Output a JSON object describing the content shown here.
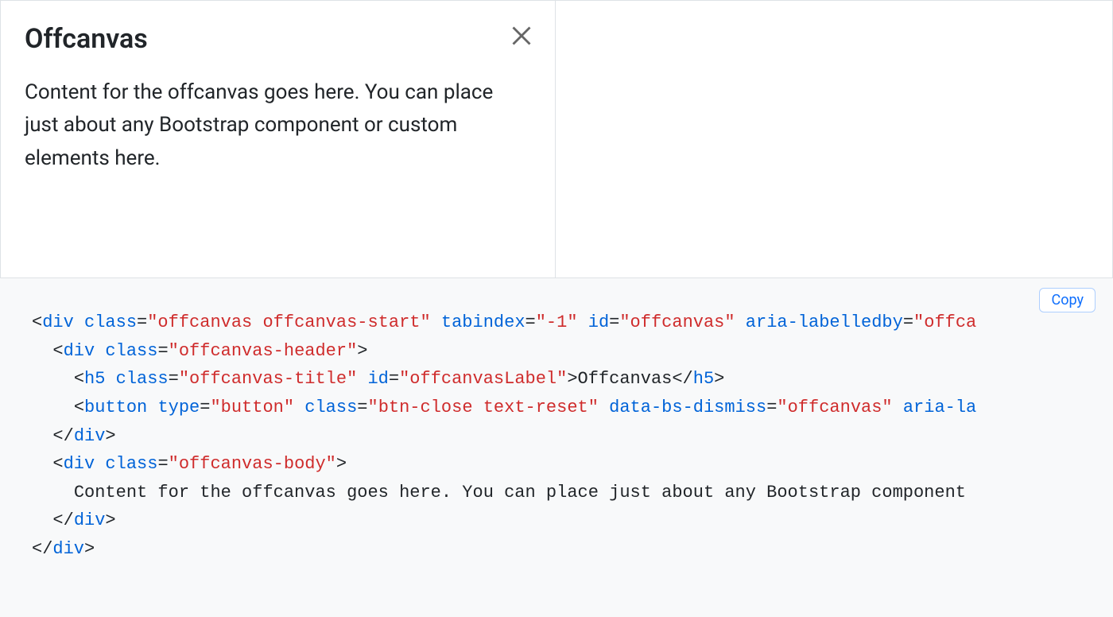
{
  "example": {
    "offcanvas": {
      "title": "Offcanvas",
      "body_text": "Content for the offcanvas goes here. You can place just about any Bootstrap component or custom elements here.",
      "close_aria": "Close"
    }
  },
  "code": {
    "copy_label": "Copy",
    "lines": {
      "l1_tag": "div",
      "l1_class": "\"offcanvas offcanvas-start\"",
      "l1_tabindex": "\"-1\"",
      "l1_id": "\"offcanvas\"",
      "l1_arialabelledby_partial": "\"offca",
      "l2_tag": "div",
      "l2_class": "\"offcanvas-header\"",
      "l3_tag": "h5",
      "l3_class": "\"offcanvas-title\"",
      "l3_id": "\"offcanvasLabel\"",
      "l3_text": "Offcanvas",
      "l4_tag": "button",
      "l4_type": "\"button\"",
      "l4_class": "\"btn-close text-reset\"",
      "l4_dismiss": "\"offcanvas\"",
      "l4_arialabel_partial": "aria-la",
      "l5_closediv": "div",
      "l6_tag": "div",
      "l6_class": "\"offcanvas-body\"",
      "l7_text": "Content for the offcanvas goes here. You can place just about any Bootstrap component",
      "l8_closediv": "div",
      "l9_closediv": "div"
    }
  }
}
